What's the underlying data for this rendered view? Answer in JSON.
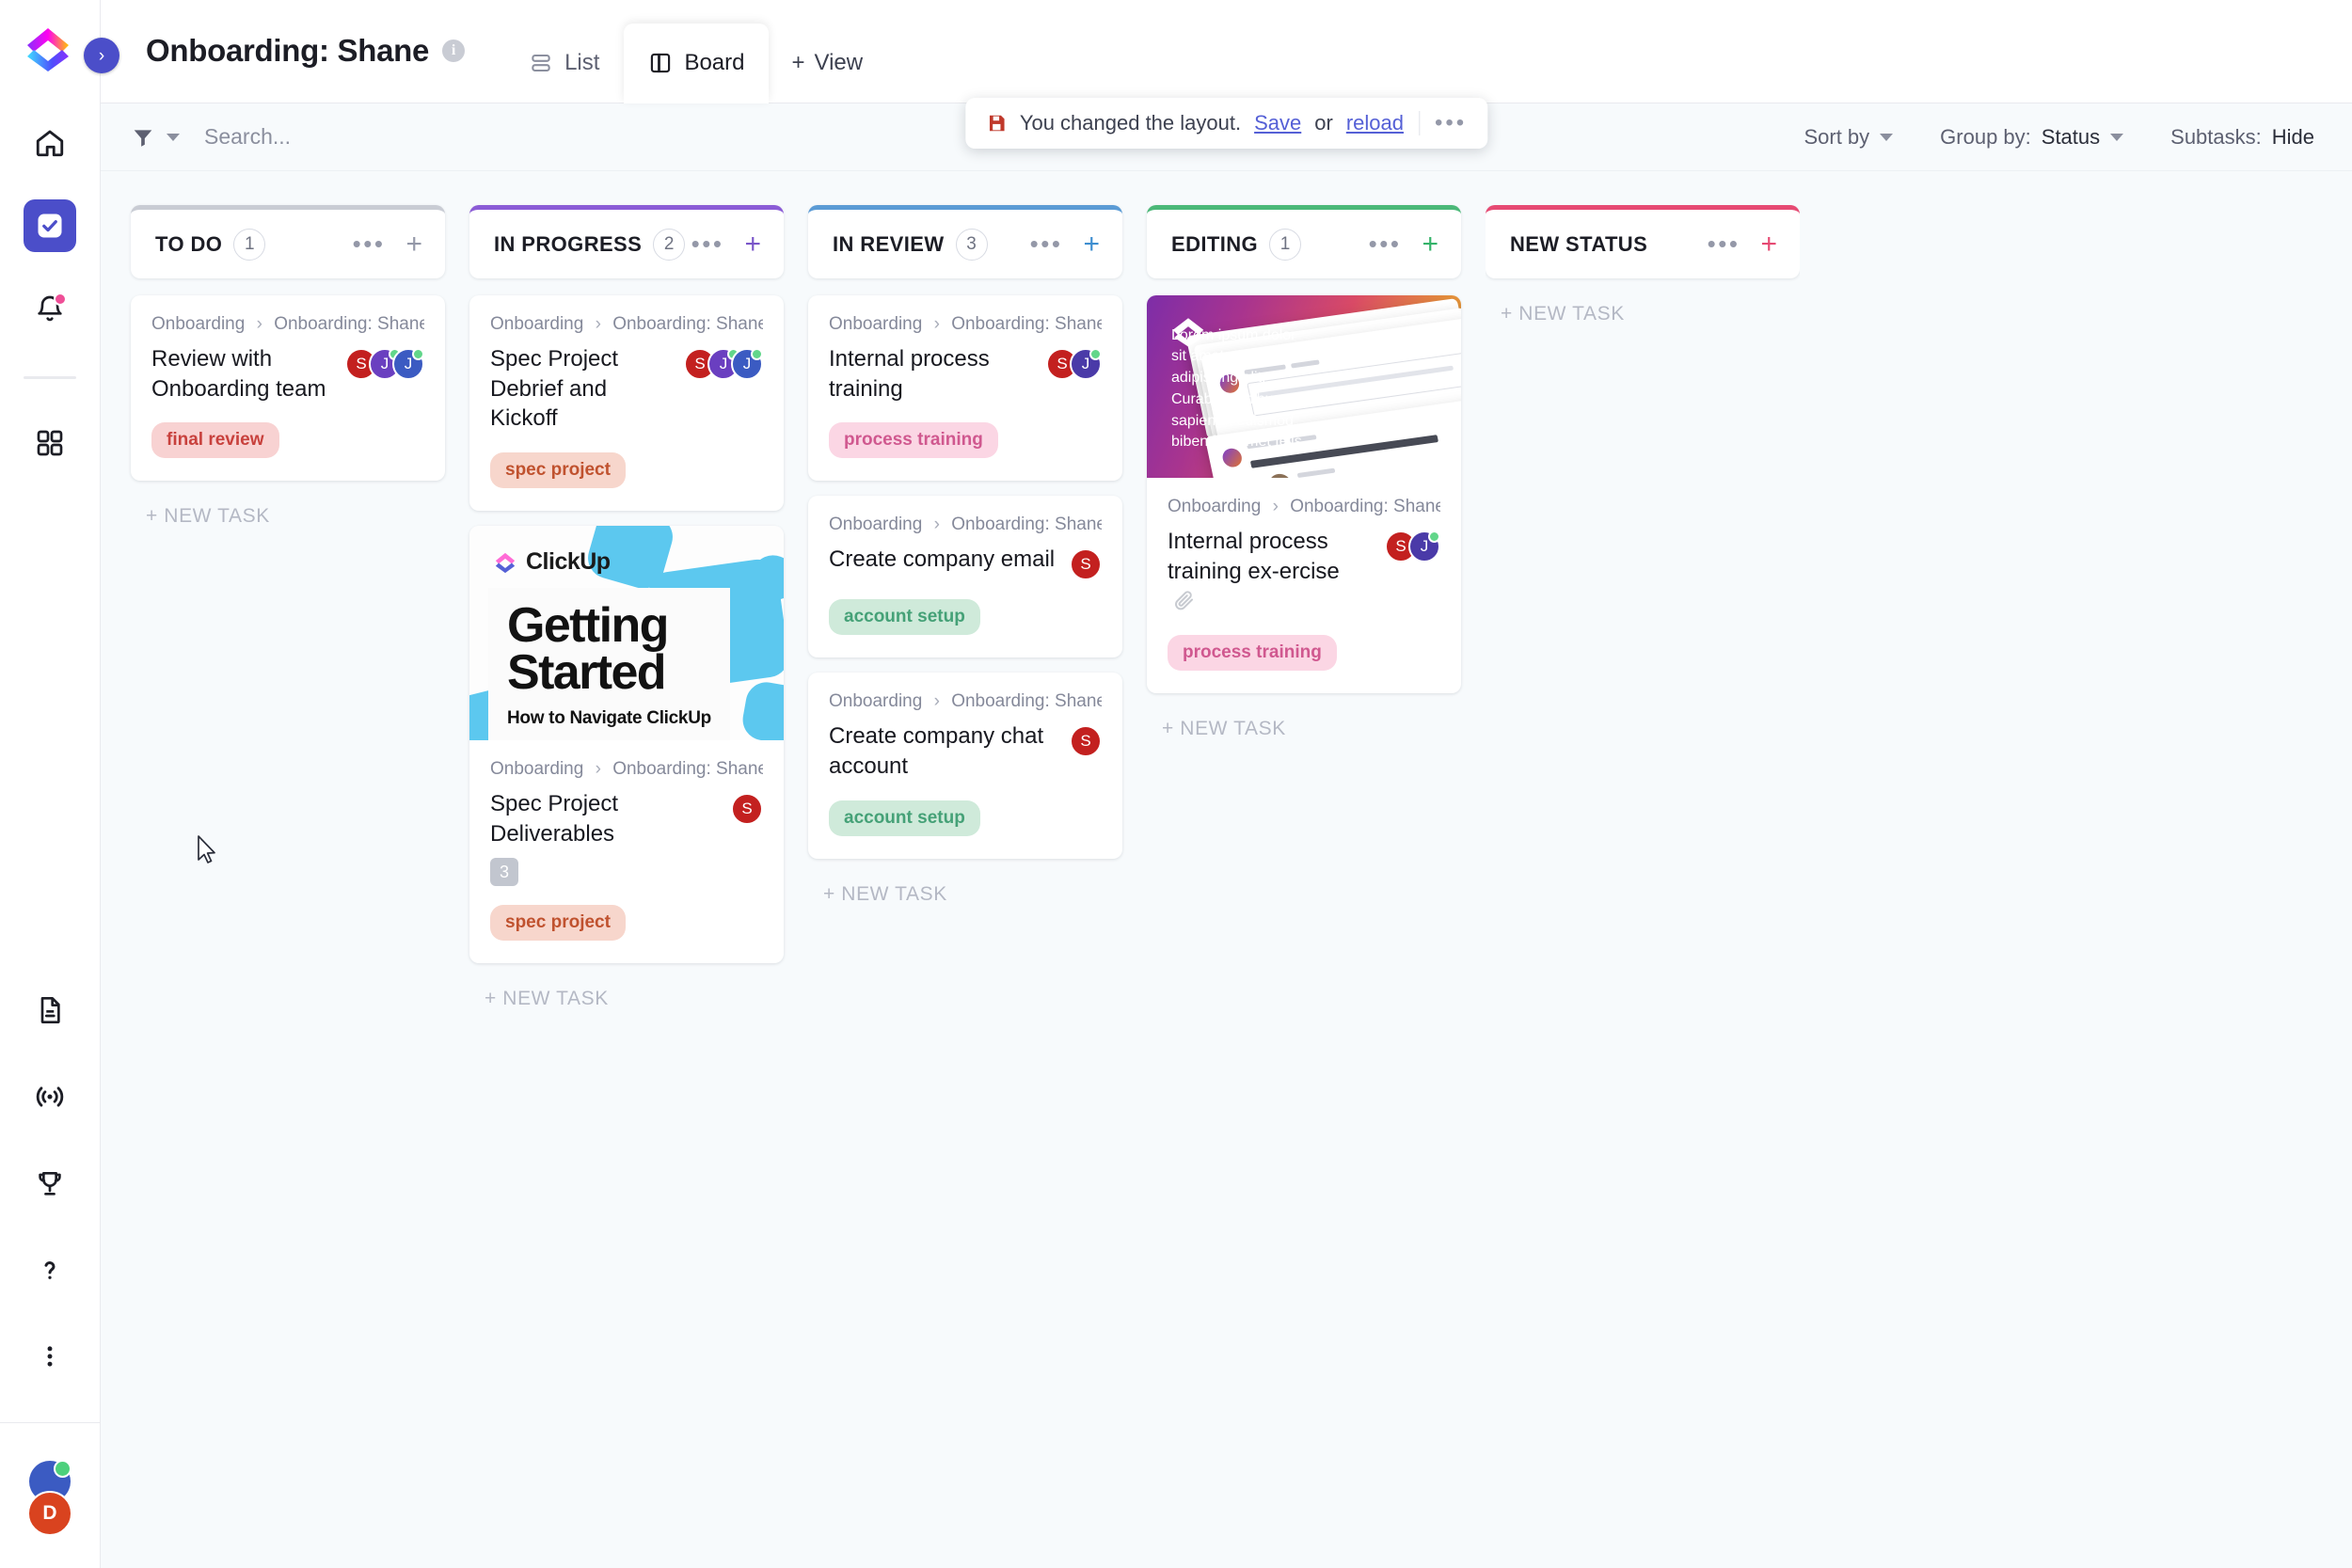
{
  "app": {
    "logo_name": "clickup-logo",
    "expand_label": "›"
  },
  "rail": {
    "items": [
      {
        "name": "home",
        "icon": "home-icon"
      },
      {
        "name": "tasks",
        "icon": "task-check-icon",
        "active": true
      },
      {
        "name": "notifications",
        "icon": "bell-icon",
        "badge": true
      },
      {
        "name": "apps",
        "icon": "apps-grid-icon"
      }
    ],
    "bottom_items": [
      {
        "name": "docs",
        "icon": "document-icon"
      },
      {
        "name": "whats-new",
        "icon": "broadcast-icon"
      },
      {
        "name": "achievements",
        "icon": "trophy-icon"
      },
      {
        "name": "help",
        "icon": "question-mark-icon"
      },
      {
        "name": "more",
        "icon": "kebab-menu-icon"
      }
    ],
    "user_avatar_initial": "D"
  },
  "header": {
    "title": "Onboarding: Shane",
    "info_icon": "info-icon",
    "tabs": [
      {
        "label": "List",
        "icon": "list-view-icon",
        "active": false
      },
      {
        "label": "Board",
        "icon": "board-view-icon",
        "active": true
      }
    ],
    "add_view_label": "View",
    "add_view_plus": "+"
  },
  "toolbar": {
    "filter_icon": "filter-funnel-icon",
    "search_placeholder": "Search...",
    "sort_by_label": "Sort by",
    "group_by_label": "Group by:",
    "group_by_value": "Status",
    "subtasks_label": "Subtasks:",
    "subtasks_value": "Hide"
  },
  "toast": {
    "icon": "save-disk-icon",
    "message": "You changed the layout.",
    "save_link": "Save",
    "or_text": "or",
    "reload_link": "reload",
    "more_dots": "•••"
  },
  "board": {
    "new_task_label": "+ NEW TASK",
    "columns": [
      {
        "name": "TO DO",
        "count": "1",
        "accent": "#c9ccd4",
        "plus_color": "#9498a8",
        "cards": [
          {
            "crumb_parent": "Onboarding",
            "crumb_child": "Onboarding: Shane",
            "title": "Review with Onboarding team",
            "avatars": [
              {
                "initial": "S",
                "color": "#c3201f",
                "online": false
              },
              {
                "initial": "J",
                "color": "#6a3fc0",
                "online": true
              },
              {
                "initial": "J",
                "color": "#3b5bc2",
                "online": true
              }
            ],
            "tags": [
              {
                "label": "final review",
                "bg": "#f8d2d2",
                "fg": "#c8413d"
              }
            ]
          }
        ]
      },
      {
        "name": "IN PROGRESS",
        "count": "2",
        "accent": "#8b5cd6",
        "plus_color": "#7a56c9",
        "cards": [
          {
            "crumb_parent": "Onboarding",
            "crumb_child": "Onboarding: Shane",
            "title": "Spec Project Debrief and Kickoff",
            "avatars": [
              {
                "initial": "S",
                "color": "#c3201f",
                "online": false
              },
              {
                "initial": "J",
                "color": "#6a3fc0",
                "online": true
              },
              {
                "initial": "J",
                "color": "#3b5bc2",
                "online": true
              }
            ],
            "tags": [
              {
                "label": "spec project",
                "bg": "#f7d6cc",
                "fg": "#c0522f"
              }
            ]
          },
          {
            "cover": "getting-started",
            "cover_logo_text": "ClickUp",
            "cover_title_line1": "Getting",
            "cover_title_line2": "Started",
            "cover_subtitle": "How to Navigate ClickUp",
            "crumb_parent": "Onboarding",
            "crumb_child": "Onboarding: Shane",
            "title": "Spec Project Deliverables",
            "subtask_count": "3",
            "avatars": [
              {
                "initial": "S",
                "color": "#c3201f",
                "online": false
              }
            ],
            "tags": [
              {
                "label": "spec project",
                "bg": "#f7d6cc",
                "fg": "#c0522f"
              }
            ]
          }
        ]
      },
      {
        "name": "IN REVIEW",
        "count": "3",
        "accent": "#5b9bd5",
        "plus_color": "#3e8ed0",
        "cards": [
          {
            "crumb_parent": "Onboarding",
            "crumb_child": "Onboarding: Shane",
            "title": "Internal process training",
            "avatars": [
              {
                "initial": "S",
                "color": "#c3201f",
                "online": false
              },
              {
                "initial": "J",
                "color": "#4a3aa8",
                "online": true
              }
            ],
            "tags": [
              {
                "label": "process training",
                "bg": "#fbd6e4",
                "fg": "#d0588f"
              }
            ]
          },
          {
            "crumb_parent": "Onboarding",
            "crumb_child": "Onboarding: Shane",
            "title": "Create company email",
            "avatars": [
              {
                "initial": "S",
                "color": "#c3201f",
                "online": false
              }
            ],
            "tags": [
              {
                "label": "account setup",
                "bg": "#cfeada",
                "fg": "#45a177"
              }
            ]
          },
          {
            "crumb_parent": "Onboarding",
            "crumb_child": "Onboarding: Shane",
            "title": "Create company chat account",
            "avatars": [
              {
                "initial": "S",
                "color": "#c3201f",
                "online": false
              }
            ],
            "tags": [
              {
                "label": "account setup",
                "bg": "#cfeada",
                "fg": "#45a177"
              }
            ]
          }
        ]
      },
      {
        "name": "EDITING",
        "count": "1",
        "accent": "#4bb878",
        "plus_color": "#34b36a",
        "cards": [
          {
            "cover": "gradient",
            "cover_lorem": "Lorem ipsum dolor sit amet, consectetur adipiscing elit. Curabitur finibus, sapien ut euismod bibendum, met felis",
            "crumb_parent": "Onboarding",
            "crumb_child": "Onboarding: Shane",
            "title": "Internal process training ex-ercise",
            "attachment_icon": "paperclip-icon",
            "avatars": [
              {
                "initial": "S",
                "color": "#c3201f",
                "online": false
              },
              {
                "initial": "J",
                "color": "#4a3aa8",
                "online": true
              }
            ],
            "tags": [
              {
                "label": "process training",
                "bg": "#fbd6e4",
                "fg": "#d0588f"
              }
            ]
          }
        ]
      },
      {
        "name": "NEW STATUS",
        "count": "",
        "accent": "#e64a73",
        "plus_color": "#e64a73",
        "cards": []
      }
    ]
  }
}
